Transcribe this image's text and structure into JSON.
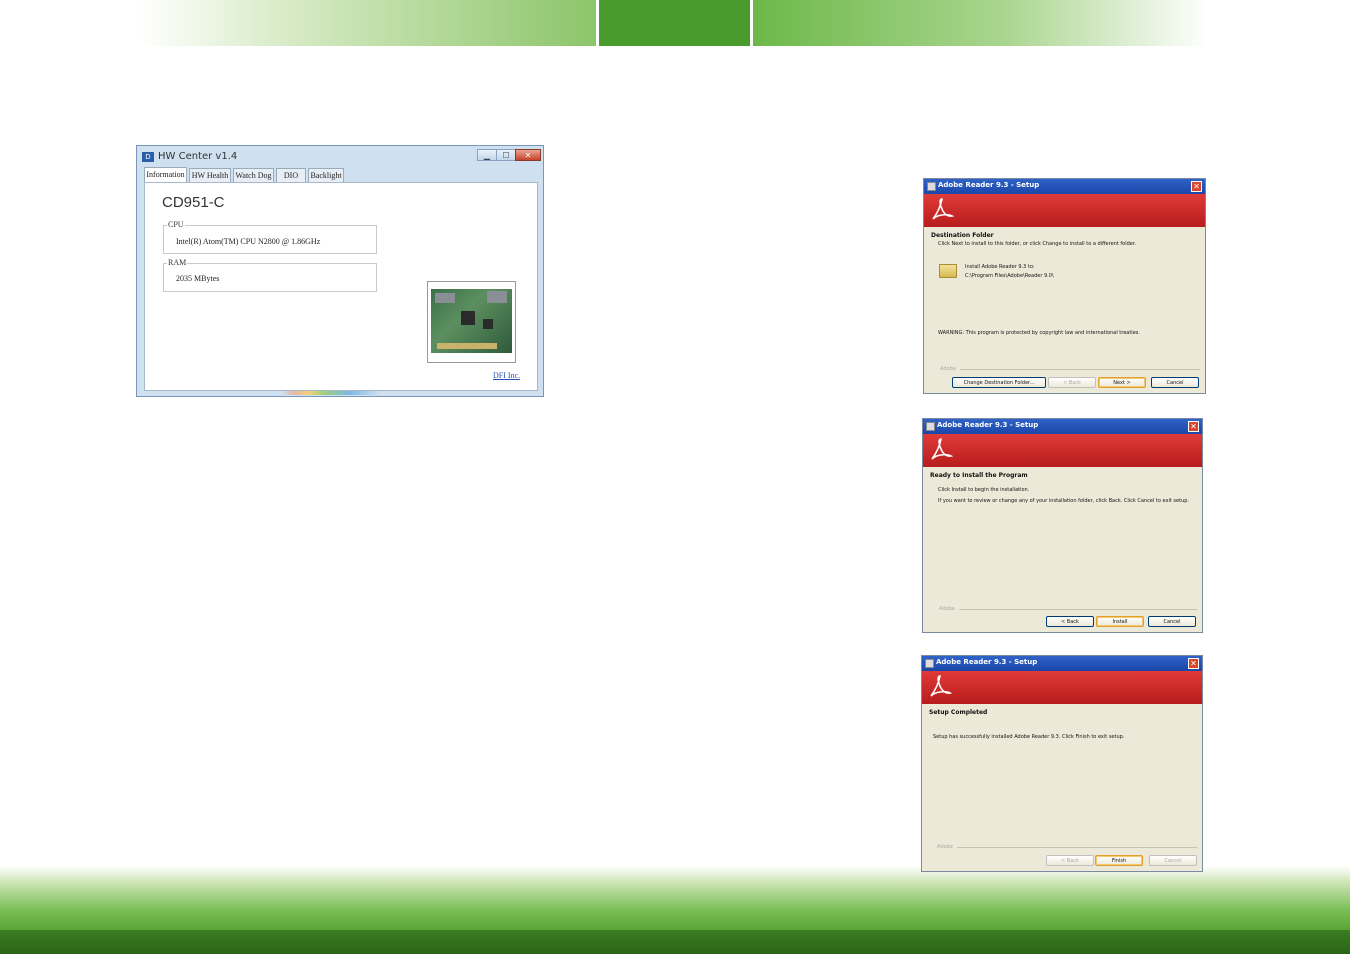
{
  "hw_center": {
    "title": "HW Center v1.4",
    "window_controls": [
      "▁",
      "☐",
      "✕"
    ],
    "tabs": [
      "Information",
      "HW Health",
      "Watch Dog",
      "DIO",
      "Backlight"
    ],
    "model": "CD951-C",
    "cpu_label": "CPU",
    "cpu_value": "Intel(R) Atom(TM) CPU N2800   @ 1.86GHz",
    "ram_label": "RAM",
    "ram_value": "2035 MBytes",
    "link": "DFI Inc."
  },
  "dialog1": {
    "title": "Adobe Reader 9.3 - Setup",
    "heading": "Destination Folder",
    "description": "Click Next to install to this folder, or click Change to install to a different folder.",
    "install_to_label": "Install Adobe Reader 9.3 to:",
    "install_path": "C:\\Program Files\\Adobe\\Reader 9.0\\",
    "warning": "WARNING: This program is protected by copyright law and international treaties.",
    "footer_label": "Adobe",
    "buttons": {
      "change": "Change Destination Folder...",
      "back": "< Back",
      "next": "Next >",
      "cancel": "Cancel"
    }
  },
  "dialog2": {
    "title": "Adobe Reader 9.3 - Setup",
    "heading": "Ready to Install the Program",
    "line1": "Click Install to begin the installation.",
    "line2": "If you want to review or change any of your installation folder, click Back. Click Cancel to exit setup.",
    "footer_label": "Adobe",
    "buttons": {
      "back": "< Back",
      "install": "Install",
      "cancel": "Cancel"
    }
  },
  "dialog3": {
    "title": "Adobe Reader 9.3 - Setup",
    "heading": "Setup Completed",
    "line1": "Setup has successfully installed Adobe Reader 9.3. Click Finish to exit setup.",
    "footer_label": "Adobe",
    "buttons": {
      "back": "< Back",
      "finish": "Finish",
      "cancel": "Cancel"
    }
  },
  "colors": {
    "brand_green": "#4a9b2e",
    "adobe_red": "#c8202a",
    "xp_blue": "#1b46a8"
  }
}
